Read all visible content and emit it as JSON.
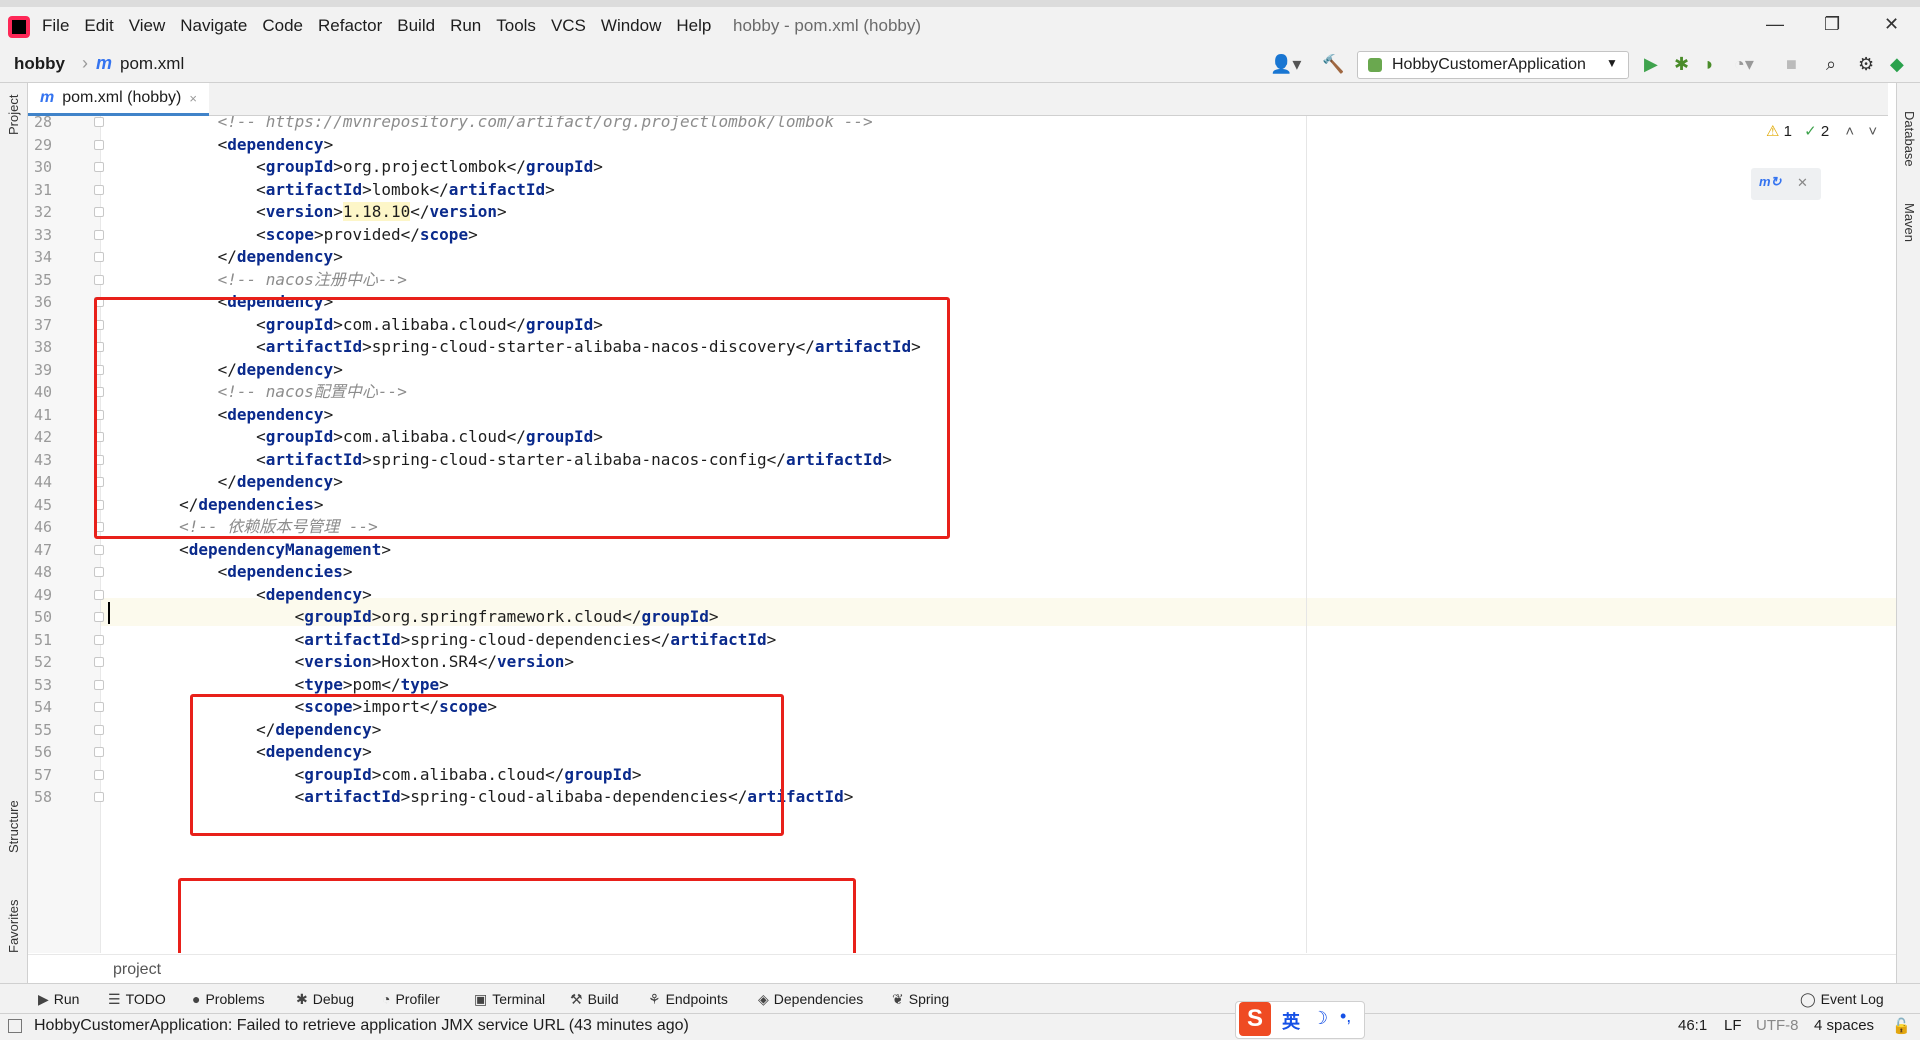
{
  "menubar": {
    "items": [
      "File",
      "Edit",
      "View",
      "Navigate",
      "Code",
      "Refactor",
      "Build",
      "Run",
      "Tools",
      "VCS",
      "Window",
      "Help"
    ],
    "title": "hobby - pom.xml (hobby)",
    "window_controls": [
      "—",
      "❐",
      "✕"
    ]
  },
  "navbar": {
    "project": "hobby",
    "separator": "›",
    "file_icon": "m",
    "file": "pom.xml",
    "run_config": "HobbyCustomerApplication"
  },
  "toolbar_icons": [
    "user-icon",
    "hammer-icon",
    "run-icon",
    "debug-icon",
    "coverage-icon",
    "profile-icon",
    "stop-icon",
    "search-icon",
    "gear-icon",
    "plugin-icon"
  ],
  "tab": {
    "icon": "m",
    "label": "pom.xml (hobby)",
    "close": "×"
  },
  "left_strip": {
    "project": "Project",
    "structure": "Structure",
    "favorites": "Favorites"
  },
  "right_strip": {
    "database": "Database",
    "maven": "Maven"
  },
  "inspection": {
    "warnings": "1",
    "ok": "2"
  },
  "editor": {
    "lines": [
      {
        "n": "28",
        "segments": [
          {
            "t": "            ",
            "c": "br"
          },
          {
            "t": "<!-- https://mvnrepository.com/artifact/org.projectlombok/lombok -->",
            "c": "cmt"
          }
        ]
      },
      {
        "n": "29",
        "segments": [
          {
            "t": "            <",
            "c": "br"
          },
          {
            "t": "dependency",
            "c": "tg"
          },
          {
            "t": ">",
            "c": "br"
          }
        ]
      },
      {
        "n": "30",
        "segments": [
          {
            "t": "                <",
            "c": "br"
          },
          {
            "t": "groupId",
            "c": "tg"
          },
          {
            "t": ">org.projectlombok</",
            "c": "br"
          },
          {
            "t": "groupId",
            "c": "tg"
          },
          {
            "t": ">",
            "c": "br"
          }
        ]
      },
      {
        "n": "31",
        "segments": [
          {
            "t": "                <",
            "c": "br"
          },
          {
            "t": "artifactId",
            "c": "tg"
          },
          {
            "t": ">lombok</",
            "c": "br"
          },
          {
            "t": "artifactId",
            "c": "tg"
          },
          {
            "t": ">",
            "c": "br"
          }
        ]
      },
      {
        "n": "32",
        "segments": [
          {
            "t": "                <",
            "c": "br"
          },
          {
            "t": "version",
            "c": "tg"
          },
          {
            "t": ">",
            "c": "br"
          },
          {
            "t": "1.18.10",
            "c": "hl"
          },
          {
            "t": "</",
            "c": "br"
          },
          {
            "t": "version",
            "c": "tg"
          },
          {
            "t": ">",
            "c": "br"
          }
        ]
      },
      {
        "n": "33",
        "segments": [
          {
            "t": "                <",
            "c": "br"
          },
          {
            "t": "scope",
            "c": "tg"
          },
          {
            "t": ">provided</",
            "c": "br"
          },
          {
            "t": "scope",
            "c": "tg"
          },
          {
            "t": ">",
            "c": "br"
          }
        ]
      },
      {
        "n": "34",
        "segments": [
          {
            "t": "            </",
            "c": "br"
          },
          {
            "t": "dependency",
            "c": "tg"
          },
          {
            "t": ">",
            "c": "br"
          }
        ]
      },
      {
        "n": "35",
        "segments": [
          {
            "t": "            ",
            "c": "br"
          },
          {
            "t": "<!-- nacos注册中心-->",
            "c": "cmt"
          }
        ]
      },
      {
        "n": "36",
        "segments": [
          {
            "t": "            <",
            "c": "br"
          },
          {
            "t": "dependency",
            "c": "tg"
          },
          {
            "t": ">",
            "c": "br"
          }
        ]
      },
      {
        "n": "37",
        "segments": [
          {
            "t": "                <",
            "c": "br"
          },
          {
            "t": "groupId",
            "c": "tg"
          },
          {
            "t": ">com.alibaba.cloud</",
            "c": "br"
          },
          {
            "t": "groupId",
            "c": "tg"
          },
          {
            "t": ">",
            "c": "br"
          }
        ]
      },
      {
        "n": "38",
        "segments": [
          {
            "t": "                <",
            "c": "br"
          },
          {
            "t": "artifactId",
            "c": "tg"
          },
          {
            "t": ">spring-cloud-starter-alibaba-nacos-discovery</",
            "c": "br"
          },
          {
            "t": "artifactId",
            "c": "tg"
          },
          {
            "t": ">",
            "c": "br"
          }
        ]
      },
      {
        "n": "39",
        "segments": [
          {
            "t": "            </",
            "c": "br"
          },
          {
            "t": "dependency",
            "c": "tg"
          },
          {
            "t": ">",
            "c": "br"
          }
        ]
      },
      {
        "n": "40",
        "segments": [
          {
            "t": "            ",
            "c": "br"
          },
          {
            "t": "<!-- nacos配置中心-->",
            "c": "cmt"
          }
        ]
      },
      {
        "n": "41",
        "segments": [
          {
            "t": "            <",
            "c": "br"
          },
          {
            "t": "dependency",
            "c": "tg"
          },
          {
            "t": ">",
            "c": "br"
          }
        ]
      },
      {
        "n": "42",
        "segments": [
          {
            "t": "                <",
            "c": "br"
          },
          {
            "t": "groupId",
            "c": "tg"
          },
          {
            "t": ">com.alibaba.cloud</",
            "c": "br"
          },
          {
            "t": "groupId",
            "c": "tg"
          },
          {
            "t": ">",
            "c": "br"
          }
        ]
      },
      {
        "n": "43",
        "segments": [
          {
            "t": "                <",
            "c": "br"
          },
          {
            "t": "artifactId",
            "c": "tg"
          },
          {
            "t": ">spring-cloud-starter-alibaba-nacos-config</",
            "c": "br"
          },
          {
            "t": "artifactId",
            "c": "tg"
          },
          {
            "t": ">",
            "c": "br"
          }
        ]
      },
      {
        "n": "44",
        "segments": [
          {
            "t": "            </",
            "c": "br"
          },
          {
            "t": "dependency",
            "c": "tg"
          },
          {
            "t": ">",
            "c": "br"
          }
        ]
      },
      {
        "n": "45",
        "segments": [
          {
            "t": "        </",
            "c": "br"
          },
          {
            "t": "dependencies",
            "c": "tg"
          },
          {
            "t": ">",
            "c": "br"
          }
        ]
      },
      {
        "n": "46",
        "segments": [
          {
            "t": "        ",
            "c": "br"
          },
          {
            "t": "<!-- 依赖版本号管理 -->",
            "c": "cmt"
          }
        ]
      },
      {
        "n": "47",
        "segments": [
          {
            "t": "        <",
            "c": "br"
          },
          {
            "t": "dependencyManagement",
            "c": "tg"
          },
          {
            "t": ">",
            "c": "br"
          }
        ]
      },
      {
        "n": "48",
        "segments": [
          {
            "t": "            <",
            "c": "br"
          },
          {
            "t": "dependencies",
            "c": "tg"
          },
          {
            "t": ">",
            "c": "br"
          }
        ]
      },
      {
        "n": "49",
        "segments": [
          {
            "t": "                <",
            "c": "br"
          },
          {
            "t": "dependency",
            "c": "tg"
          },
          {
            "t": ">",
            "c": "br"
          }
        ]
      },
      {
        "n": "50",
        "segments": [
          {
            "t": "                    <",
            "c": "br"
          },
          {
            "t": "groupId",
            "c": "tg"
          },
          {
            "t": ">org.springframework.cloud</",
            "c": "br"
          },
          {
            "t": "groupId",
            "c": "tg"
          },
          {
            "t": ">",
            "c": "br"
          }
        ]
      },
      {
        "n": "51",
        "segments": [
          {
            "t": "                    <",
            "c": "br"
          },
          {
            "t": "artifactId",
            "c": "tg"
          },
          {
            "t": ">spring-cloud-dependencies</",
            "c": "br"
          },
          {
            "t": "artifactId",
            "c": "tg"
          },
          {
            "t": ">",
            "c": "br"
          }
        ]
      },
      {
        "n": "52",
        "segments": [
          {
            "t": "                    <",
            "c": "br"
          },
          {
            "t": "version",
            "c": "tg"
          },
          {
            "t": ">Hoxton.SR4</",
            "c": "br"
          },
          {
            "t": "version",
            "c": "tg"
          },
          {
            "t": ">",
            "c": "br"
          }
        ]
      },
      {
        "n": "53",
        "segments": [
          {
            "t": "                    <",
            "c": "br"
          },
          {
            "t": "type",
            "c": "tg"
          },
          {
            "t": ">pom</",
            "c": "br"
          },
          {
            "t": "type",
            "c": "tg"
          },
          {
            "t": ">",
            "c": "br"
          }
        ]
      },
      {
        "n": "54",
        "segments": [
          {
            "t": "                    <",
            "c": "br"
          },
          {
            "t": "scope",
            "c": "tg"
          },
          {
            "t": ">import</",
            "c": "br"
          },
          {
            "t": "scope",
            "c": "tg"
          },
          {
            "t": ">",
            "c": "br"
          }
        ]
      },
      {
        "n": "55",
        "segments": [
          {
            "t": "                </",
            "c": "br"
          },
          {
            "t": "dependency",
            "c": "tg"
          },
          {
            "t": ">",
            "c": "br"
          }
        ]
      },
      {
        "n": "56",
        "segments": [
          {
            "t": "                <",
            "c": "br"
          },
          {
            "t": "dependency",
            "c": "tg"
          },
          {
            "t": ">",
            "c": "br"
          }
        ]
      },
      {
        "n": "57",
        "segments": [
          {
            "t": "                    <",
            "c": "br"
          },
          {
            "t": "groupId",
            "c": "tg"
          },
          {
            "t": ">com.alibaba.cloud</",
            "c": "br"
          },
          {
            "t": "groupId",
            "c": "tg"
          },
          {
            "t": ">",
            "c": "br"
          }
        ]
      },
      {
        "n": "58",
        "segments": [
          {
            "t": "                    <",
            "c": "br"
          },
          {
            "t": "artifactId",
            "c": "tg"
          },
          {
            "t": ">spring-cloud-alibaba-dependencies</",
            "c": "br"
          },
          {
            "t": "artifactId",
            "c": "tg"
          },
          {
            "t": ">",
            "c": "br"
          }
        ]
      }
    ],
    "caret_line": "46"
  },
  "breadcrumb_bottom": "project",
  "tool_windows": [
    {
      "icon": "▶",
      "label": "Run"
    },
    {
      "icon": "☰",
      "label": "TODO"
    },
    {
      "icon": "●",
      "label": "Problems"
    },
    {
      "icon": "✱",
      "label": "Debug"
    },
    {
      "icon": "◔",
      "label": "Profiler"
    },
    {
      "icon": "▣",
      "label": "Terminal"
    },
    {
      "icon": "⚒",
      "label": "Build"
    },
    {
      "icon": "⚘",
      "label": "Endpoints"
    },
    {
      "icon": "◈",
      "label": "Dependencies"
    },
    {
      "icon": "❦",
      "label": "Spring"
    }
  ],
  "event_log": "Event Log",
  "status": {
    "message": "HobbyCustomerApplication: Failed to retrieve application JMX service URL (43 minutes ago)",
    "position": "46:1",
    "line_sep": "LF",
    "encoding": "UTF-8",
    "indent": "4 spaces"
  },
  "ime": {
    "logo": "S",
    "lang": "英",
    "moon": "☽",
    "punct": "•,"
  }
}
